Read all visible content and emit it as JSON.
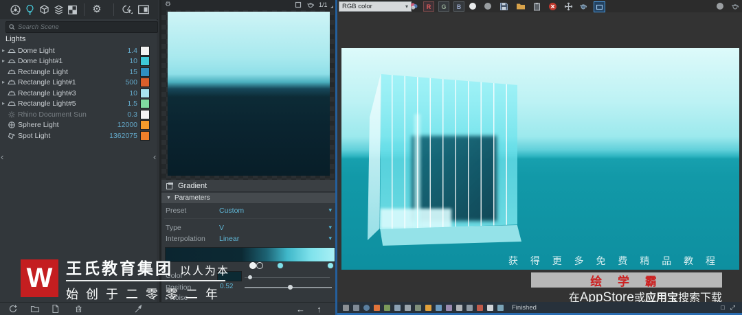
{
  "glyphs": {
    "gear": "⚙",
    "collapse_arrow": "▼",
    "expand_arrow": "▸",
    "chevron_down": "▾",
    "back_arrow": "←",
    "up_arrow": "↑",
    "panel_collapse": "‹",
    "window_box": "❐",
    "stats_box": "□",
    "resize": "⤢"
  },
  "asset_editor": {
    "search_placeholder": "Search Scene",
    "section_title": "Lights",
    "lights": [
      {
        "name": "Dome Light",
        "value": "1.4",
        "arrow": "▸",
        "color": "#f2f2f2"
      },
      {
        "name": "Dome Light#1",
        "value": "10",
        "arrow": "▸",
        "color": "#3ec8d8"
      },
      {
        "name": "Rectangle Light",
        "value": "15",
        "arrow": "",
        "color": "#2f8fc0"
      },
      {
        "name": "Rectangle Light#1",
        "value": "500",
        "arrow": "▸",
        "color": "#d95f2b"
      },
      {
        "name": "Rectangle Light#3",
        "value": "10",
        "arrow": "",
        "color": "#a8e4ee"
      },
      {
        "name": "Rectangle Light#5",
        "value": "1.5",
        "arrow": "▸",
        "color": "#7fd9a0"
      },
      {
        "name": "Rhino Document Sun",
        "value": "0.3",
        "arrow": "",
        "color": "#f2f2f2"
      },
      {
        "name": "Sphere Light",
        "value": "12000",
        "arrow": "",
        "color": "#f49b2b"
      },
      {
        "name": "Spot Light",
        "value": "1362075",
        "arrow": "",
        "color": "#ef7f2a"
      }
    ],
    "preview_scale": "1/1",
    "gradient": {
      "title": "Gradient",
      "parameters_label": "Parameters",
      "preset_label": "Preset",
      "preset_value": "Custom",
      "type_label": "Type",
      "type_value": "V",
      "interpolation_label": "Interpolation",
      "interpolation_value": "Linear",
      "color_label": "Color",
      "position_label": "Position",
      "position_value": "0.52",
      "noise_label": "Noise"
    }
  },
  "vfb": {
    "channel_select_value": "RGB color",
    "channel_buttons": {
      "r": "R",
      "g": "G",
      "b": "B"
    },
    "status_text": "Finished"
  },
  "watermark_left": {
    "logo_letter": "W",
    "brand": "王氏教育集团",
    "slogan": "以人为本",
    "founded": "始创于二零零二年"
  },
  "watermark_right": {
    "line1": "获 得 更 多 免 费 精 品 教 程",
    "app_name": "绘 学 霸",
    "line3_prefix": "在",
    "store1": "AppStore",
    "conj": "或",
    "store2": "应用宝",
    "suffix": "搜索下载"
  }
}
